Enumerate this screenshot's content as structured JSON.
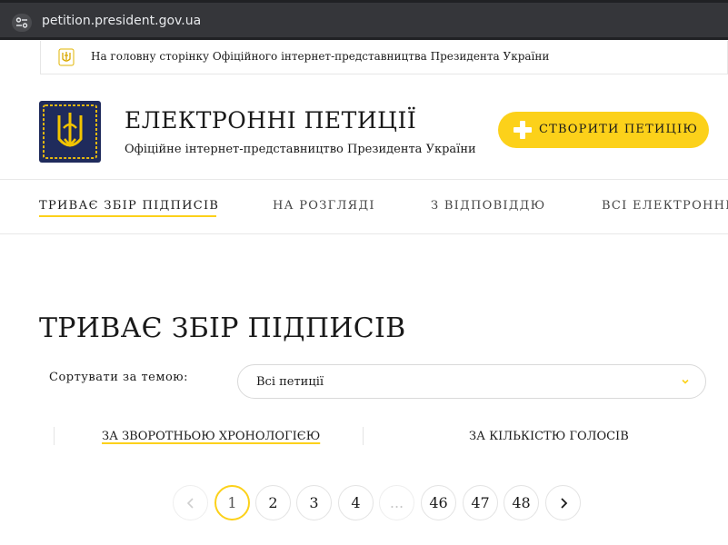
{
  "browser": {
    "url": "petition.president.gov.ua",
    "site_info_icon": "tune-icon"
  },
  "top_link": {
    "text": "На головну сторінку Офіційного інтернет-представництва Президента України",
    "icon": "trident-emblem-icon"
  },
  "header": {
    "title": "ЕЛЕКТРОННІ ПЕТИЦІЇ",
    "subtitle": "Офіційне інтернет-представництво Президента України",
    "create_button": "СТВОРИТИ ПЕТИЦІЮ",
    "logo": "trident-emblem-icon"
  },
  "nav": {
    "tabs": [
      {
        "label": "ТРИВАЄ ЗБІР ПІДПИСІВ",
        "active": true
      },
      {
        "label": "НА РОЗГЛЯДІ",
        "active": false
      },
      {
        "label": "З ВІДПОВІДДЮ",
        "active": false
      },
      {
        "label": "ВСІ ЕЛЕКТРОННІ",
        "active": false
      }
    ]
  },
  "main": {
    "title": "ТРИВАЄ ЗБІР ПІДПИСІВ",
    "sort_label": "Сортувати за темою:",
    "topic_select": {
      "value": "Всі петиції"
    },
    "sort_options": [
      {
        "label": "ЗА ЗВОРОТНЬОЮ ХРОНОЛОГІЄЮ",
        "active": true
      },
      {
        "label": "ЗА КІЛЬКІСТЮ ГОЛОСІВ",
        "active": false
      }
    ]
  },
  "pagination": {
    "pages": [
      "1",
      "2",
      "3",
      "4",
      "...",
      "46",
      "47",
      "48"
    ],
    "current": "1"
  },
  "colors": {
    "accent": "#fcd11a",
    "emblem_bg": "#1f2b5c",
    "address_bar": "#35363a"
  }
}
